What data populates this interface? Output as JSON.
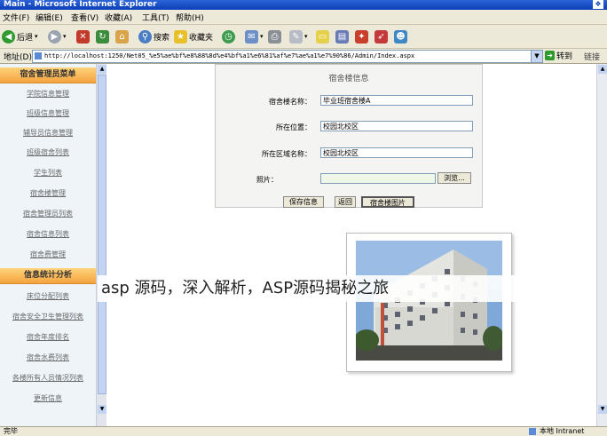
{
  "window": {
    "title": "Main - Microsoft Internet Explorer"
  },
  "menu": [
    "文件(F)",
    "编辑(E)",
    "查看(V)",
    "收藏(A)",
    "工具(T)",
    "帮助(H)"
  ],
  "toolbar": {
    "back_label": "后退",
    "search_label": "搜索",
    "favorites_label": "收藏夹"
  },
  "address": {
    "label": "地址(D)",
    "url": "http://localhost:1250/Net05_%e5%ae%bf%e8%88%8d%e4%bf%a1%e6%81%af%e7%ae%a1%e7%90%86/Admin/Index.aspx",
    "go_label": "转到",
    "links_label": "链接"
  },
  "sidebar": {
    "section1_title": "宿舍管理员菜单",
    "section1_items": [
      "学院信息管理",
      "班级信息管理",
      "辅导员信息管理",
      "班级宿舍列表",
      "学生列表",
      "宿舍楼管理",
      "宿舍管理员列表",
      "宿舍信息列表",
      "宿舍费管理"
    ],
    "section2_title": "信息统计分析",
    "section2_items": [
      "床位分配列表",
      "宿舍安全卫生管理列表",
      "宿舍年度排名",
      "宿舍水费列表",
      "各楼所有人员情况列表",
      "更新信息"
    ]
  },
  "form": {
    "title": "宿舍楼信息",
    "building_name_label": "宿舍楼名称：",
    "building_name_value": "毕业班宿舍楼A",
    "location_label": "所在位置：",
    "location_value": "校园北校区",
    "area_label": "所在区域名称：",
    "area_value": "校园北校区",
    "photo_label": "照片：",
    "browse_label": "浏览...",
    "save_label": "保存信息",
    "back_label": "返回",
    "photo_button_label": "宿舍楼图片"
  },
  "overlay_text": "asp 源码，深入解析，ASP源码揭秘之旅",
  "status": {
    "left": "完毕",
    "right": "本地 Intranet"
  }
}
